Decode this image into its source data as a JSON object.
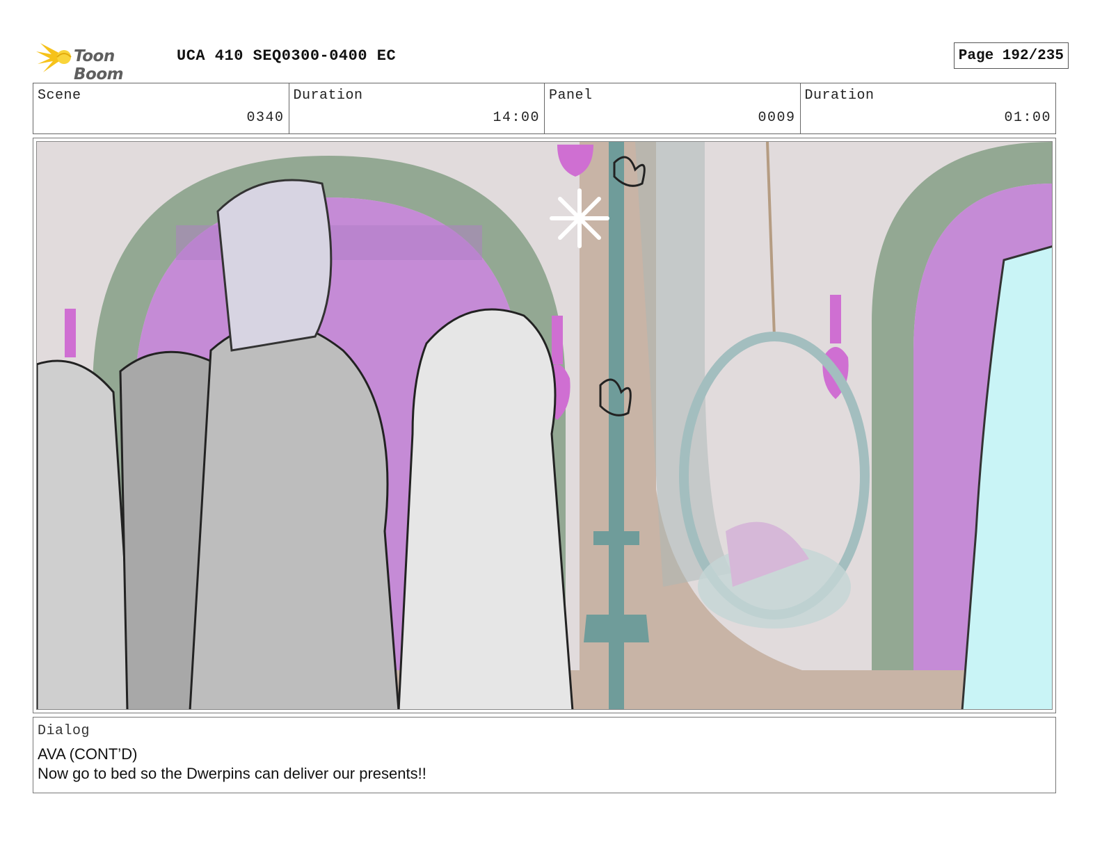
{
  "header": {
    "logo_text": "Toon Boom",
    "title": "UCA 410 SEQ0300-0400 EC",
    "page": "Page 192/235"
  },
  "info": {
    "scene_label": "Scene",
    "scene_value": "0340",
    "scene_duration_label": "Duration",
    "scene_duration_value": "14:00",
    "panel_label": "Panel",
    "panel_value": "0009",
    "panel_duration_label": "Duration",
    "panel_duration_value": "01:00"
  },
  "dialog": {
    "label": "Dialog",
    "speaker": "AVA (CONT’D)",
    "line": "Now go to bed so the Dwerpins can deliver our presents!!"
  },
  "colors": {
    "logo_yellow": "#f6c21a",
    "arch_green": "#93a893",
    "window_magenta": "#c58bd6",
    "lamp_magenta": "#cf6fd2",
    "pole_teal": "#6f9c9a",
    "unicorn_cyan": "#c9f4f6",
    "wall_tan": "#c8b4a6"
  }
}
